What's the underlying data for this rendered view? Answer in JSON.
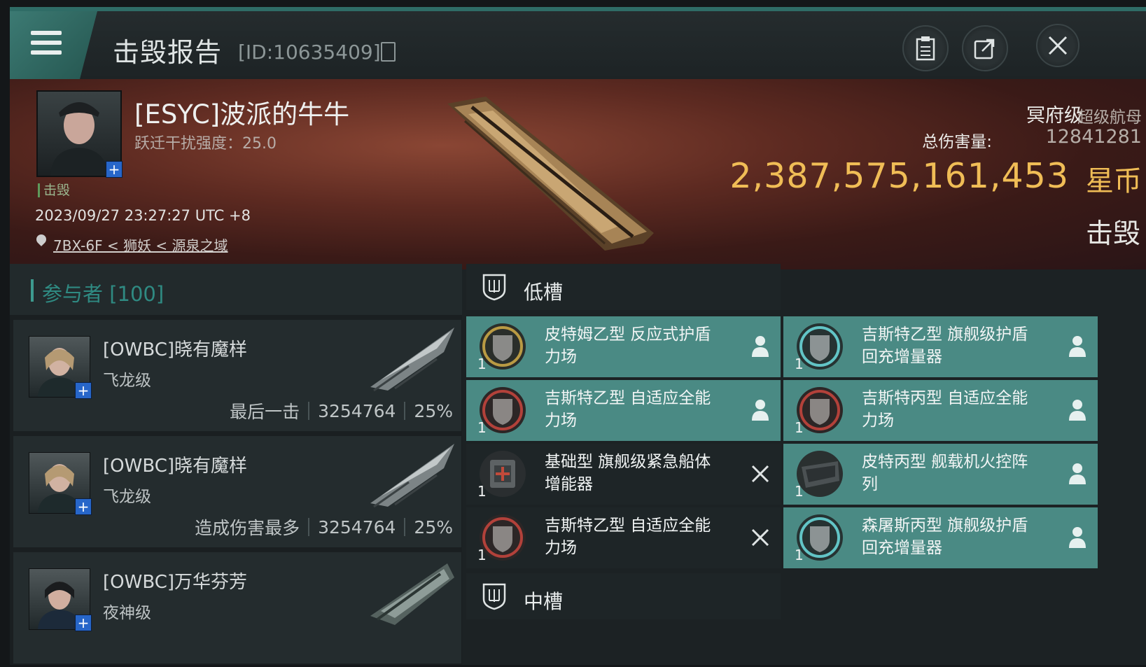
{
  "header": {
    "title": "击毁报告",
    "report_id": "[ID:10635409]",
    "colors": {
      "accent": "#3d8a82",
      "isk": "#f0bd56"
    }
  },
  "victim": {
    "name": "[ESYC]波派的牛牛",
    "warp_jam": "跃迁干扰强度：25.0",
    "status_tag": "击毁",
    "timestamp": "2023/09/27 23:27:27 UTC +8",
    "location": "7BX-6F < 狮妖 < 源泉之域",
    "ship_class": "冥府级",
    "ship_type": "超级航母",
    "damage_label": "总伤害量:",
    "damage_value": "12841281",
    "isk_value": "2,387,575,161,453",
    "isk_unit": "星币",
    "result": "击毁"
  },
  "participants": {
    "label": "参与者 [100]",
    "items": [
      {
        "name": "[OWBC]晓有魔样",
        "ship": "飞龙级",
        "tag": "最后一击",
        "damage": "3254764",
        "percent": "25%"
      },
      {
        "name": "[OWBC]晓有魔样",
        "ship": "飞龙级",
        "tag": "造成伤害最多",
        "damage": "3254764",
        "percent": "25%"
      },
      {
        "name": "[OWBC]万华芬芳",
        "ship": "夜神级"
      }
    ]
  },
  "slots": {
    "low": {
      "label": "低槽",
      "items": [
        {
          "name": "皮特姆乙型 反应式护盾力场",
          "qty": "1",
          "state": "dropped",
          "icon": "shield-gold-icon"
        },
        {
          "name": "吉斯特乙型 旗舰级护盾回充增量器",
          "qty": "1",
          "state": "dropped",
          "icon": "shield-cyan-icon"
        },
        {
          "name": "吉斯特乙型 自适应全能力场",
          "qty": "1",
          "state": "dropped",
          "icon": "shield-red-icon"
        },
        {
          "name": "吉斯特丙型 自适应全能力场",
          "qty": "1",
          "state": "dropped",
          "icon": "shield-red-icon"
        },
        {
          "name": "基础型 旗舰级紧急船体增能器",
          "qty": "1",
          "state": "destroyed",
          "icon": "hull-module-icon"
        },
        {
          "name": "皮特丙型 舰载机火控阵列",
          "qty": "1",
          "state": "dropped",
          "icon": "fighter-module-icon"
        },
        {
          "name": "吉斯特乙型 自适应全能力场",
          "qty": "1",
          "state": "destroyed",
          "icon": "shield-red-icon"
        },
        {
          "name": "森屠斯丙型 旗舰级护盾回充增量器",
          "qty": "1",
          "state": "dropped",
          "icon": "shield-cyan-icon"
        }
      ]
    },
    "mid": {
      "label": "中槽"
    }
  }
}
